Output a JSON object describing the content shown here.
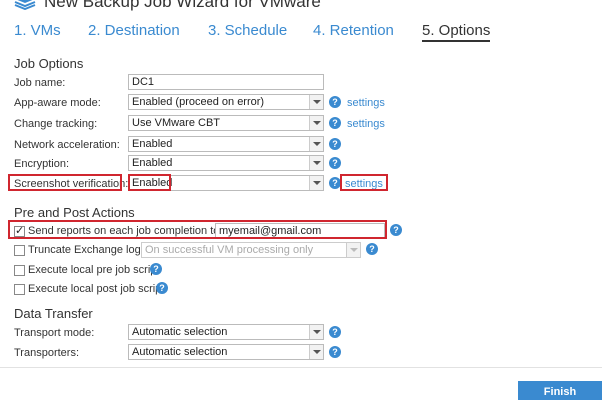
{
  "window": {
    "title": "New Backup Job Wizard for VMware"
  },
  "tabs": [
    {
      "label": "1. VMs"
    },
    {
      "label": "2. Destination"
    },
    {
      "label": "3. Schedule"
    },
    {
      "label": "4. Retention"
    },
    {
      "label": "5. Options",
      "active": true
    }
  ],
  "job_options": {
    "title": "Job Options",
    "job_name": {
      "label": "Job name:",
      "value": "DC1"
    },
    "app_aware": {
      "label": "App-aware mode:",
      "value": "Enabled (proceed on error)",
      "link": "settings"
    },
    "change_tracking": {
      "label": "Change tracking:",
      "value": "Use VMware CBT",
      "link": "settings"
    },
    "network_acceleration": {
      "label": "Network acceleration:",
      "value": "Enabled"
    },
    "encryption": {
      "label": "Encryption:",
      "value": "Enabled"
    },
    "screenshot_verification": {
      "label": "Screenshot verification:",
      "value": "Enabled",
      "link": "settings"
    }
  },
  "pre_post": {
    "title": "Pre and Post Actions",
    "send_reports": {
      "label": "Send reports on each job completion to:",
      "checked": true,
      "value": "myemail@gmail.com"
    },
    "truncate_exchange": {
      "label": "Truncate Exchange logs",
      "checked": false,
      "value": "On successful VM processing only"
    },
    "pre_job_script": {
      "label": "Execute local pre job script",
      "checked": false
    },
    "post_job_script": {
      "label": "Execute local post job script",
      "checked": false
    }
  },
  "data_transfer": {
    "title": "Data Transfer",
    "transport_mode": {
      "label": "Transport mode:",
      "value": "Automatic selection"
    },
    "transporters": {
      "label": "Transporters:",
      "value": "Automatic selection"
    }
  },
  "footer": {
    "finish_label": "Finish"
  },
  "colors": {
    "accent": "#3a8ad0",
    "highlight": "#d0262f"
  },
  "icons": {
    "logo": "stacked-layers-icon",
    "help": "question-circle-icon",
    "dropdown": "chevron-down-icon",
    "check": "checkmark-icon"
  }
}
